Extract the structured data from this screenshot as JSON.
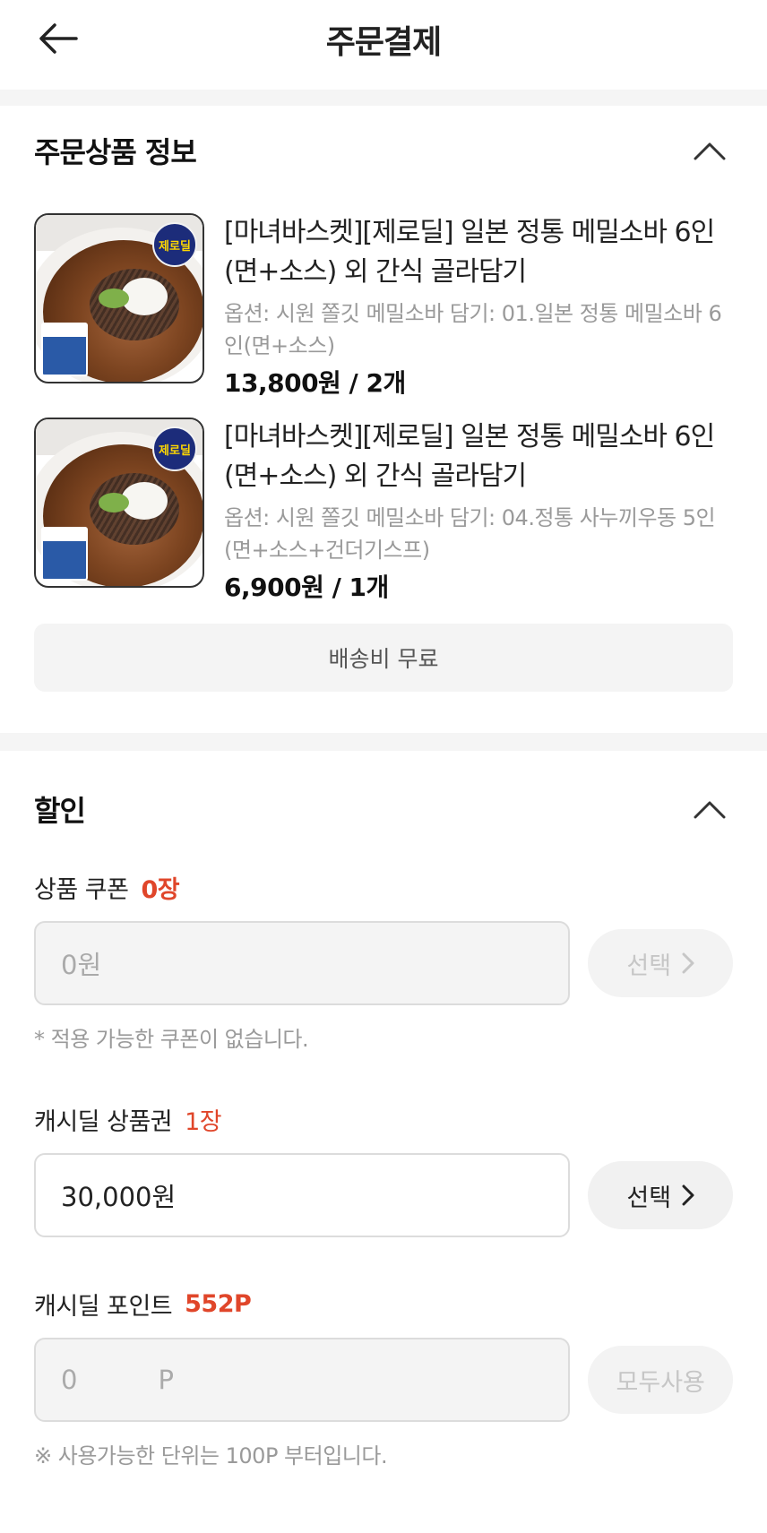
{
  "header": {
    "title": "주문결제"
  },
  "order_section": {
    "title": "주문상품 정보",
    "items": [
      {
        "name": "[마녀바스켓][제로딜] 일본 정통 메밀소바 6인(면+소스) 외 간식 골라담기",
        "option": "옵션: 시원 쫄깃 메밀소바 담기: 01.일본 정통 메밀소바 6인(면+소스)",
        "price": "13,800원 / 2개",
        "badge": "제로딜"
      },
      {
        "name": "[마녀바스켓][제로딜] 일본 정통 메밀소바 6인(면+소스) 외 간식 골라담기",
        "option": "옵션: 시원 쫄깃 메밀소바 담기: 04.정통 사누끼우동 5인(면+소스+건더기스프)",
        "price": "6,900원 / 1개",
        "badge": "제로딜"
      }
    ],
    "shipping": "배송비 무료"
  },
  "discount_section": {
    "title": "할인",
    "coupon": {
      "label": "상품 쿠폰",
      "count": "0장",
      "value": "0원",
      "button": "선택",
      "note": "* 적용 가능한 쿠폰이 없습니다."
    },
    "voucher": {
      "label": "캐시딜 상품권",
      "count": "1장",
      "value": "30,000원",
      "button": "선택"
    },
    "points": {
      "label": "캐시딜 포인트",
      "count": "552P",
      "value": "0",
      "unit": "P",
      "button": "모두사용",
      "note": "※ 사용가능한 단위는 100P 부터입니다."
    }
  },
  "colors": {
    "accent": "#e0462a"
  }
}
